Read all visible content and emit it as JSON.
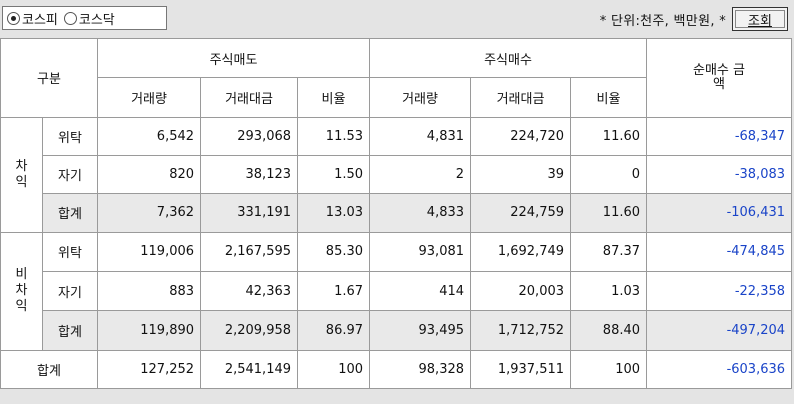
{
  "toolbar": {
    "market_options": [
      {
        "label": "코스피",
        "selected": true
      },
      {
        "label": "코스닥",
        "selected": false
      }
    ],
    "unit_note": "* 단위:천주, 백만원, *",
    "query_button": "조회"
  },
  "table": {
    "header": {
      "category": "구분",
      "sell_group": "주식매도",
      "buy_group": "주식매수",
      "net_buy": "순매수 금액",
      "volume": "거래량",
      "amount": "거래대금",
      "ratio": "비율"
    },
    "groups": [
      {
        "label": "차익",
        "rows": [
          {
            "sub": "위탁",
            "sell_vol": "6,542",
            "sell_amt": "293,068",
            "sell_ratio": "11.53",
            "buy_vol": "4,831",
            "buy_amt": "224,720",
            "buy_ratio": "11.60",
            "net": "-68,347"
          },
          {
            "sub": "자기",
            "sell_vol": "820",
            "sell_amt": "38,123",
            "sell_ratio": "1.50",
            "buy_vol": "2",
            "buy_amt": "39",
            "buy_ratio": "0",
            "net": "-38,083"
          },
          {
            "sub": "합계",
            "sell_vol": "7,362",
            "sell_amt": "331,191",
            "sell_ratio": "13.03",
            "buy_vol": "4,833",
            "buy_amt": "224,759",
            "buy_ratio": "11.60",
            "net": "-106,431"
          }
        ]
      },
      {
        "label": "비차익",
        "rows": [
          {
            "sub": "위탁",
            "sell_vol": "119,006",
            "sell_amt": "2,167,595",
            "sell_ratio": "85.30",
            "buy_vol": "93,081",
            "buy_amt": "1,692,749",
            "buy_ratio": "87.37",
            "net": "-474,845"
          },
          {
            "sub": "자기",
            "sell_vol": "883",
            "sell_amt": "42,363",
            "sell_ratio": "1.67",
            "buy_vol": "414",
            "buy_amt": "20,003",
            "buy_ratio": "1.03",
            "net": "-22,358"
          },
          {
            "sub": "합계",
            "sell_vol": "119,890",
            "sell_amt": "2,209,958",
            "sell_ratio": "86.97",
            "buy_vol": "93,495",
            "buy_amt": "1,712,752",
            "buy_ratio": "88.40",
            "net": "-497,204"
          }
        ]
      }
    ],
    "total": {
      "label": "합계",
      "sell_vol": "127,252",
      "sell_amt": "2,541,149",
      "sell_ratio": "100",
      "buy_vol": "98,328",
      "buy_amt": "1,937,511",
      "buy_ratio": "100",
      "net": "-603,636"
    }
  },
  "colors": {
    "net_value": "#1a44c8",
    "sum_row_bg": "#e9e9e9"
  }
}
